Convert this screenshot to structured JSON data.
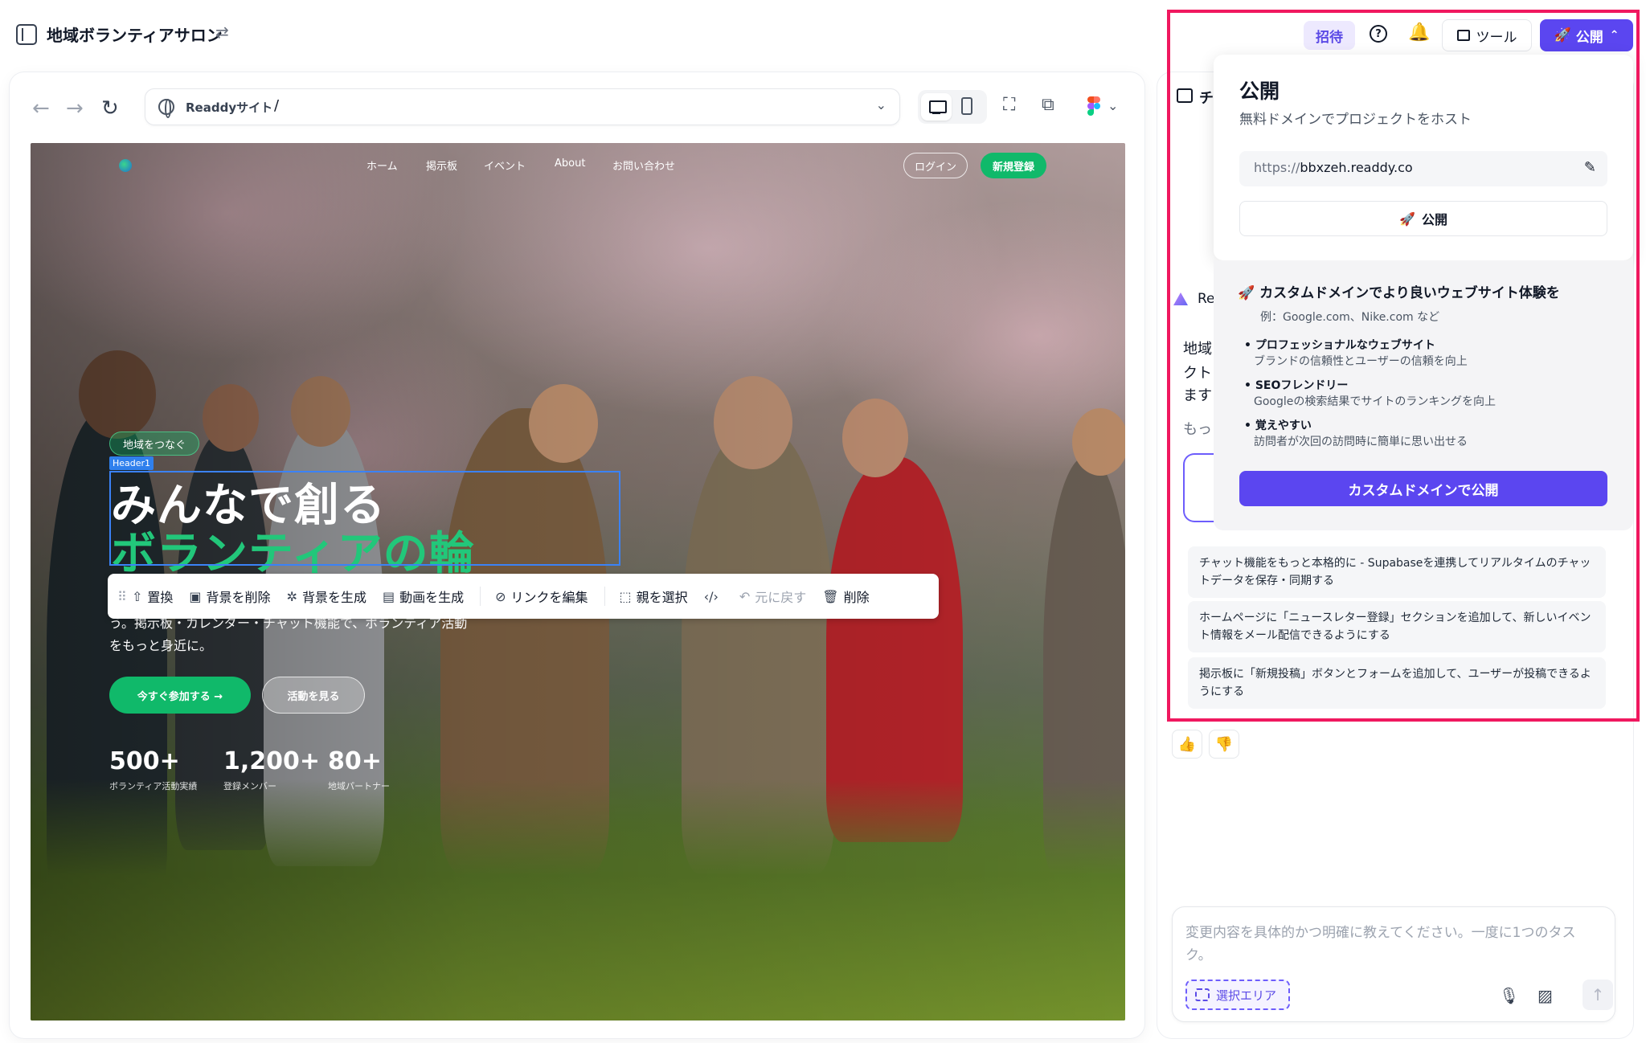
{
  "app": {
    "project_title": "地域ボランティアサロン"
  },
  "browser": {
    "site_name": "Readdyサイト",
    "path": "/"
  },
  "site": {
    "nav": [
      "ホーム",
      "掲示板",
      "イベント",
      "About",
      "お問い合わせ"
    ],
    "login_label": "ログイン",
    "signup_label": "新規登録",
    "badge": "地域をつなぐ",
    "selection_label": "Header1",
    "headline_1": "みんなで創る",
    "headline_2": "ボランティアの輪",
    "desc_line_1": "う。掲示板・カレンダー・チャット機能で、ボランティア活動",
    "desc_line_2": "をもっと身近に。",
    "cta_join": "今すぐ参加する →",
    "cta_view": "活動を見る",
    "stats": [
      {
        "value": "500+",
        "label": "ボランティア活動実績"
      },
      {
        "value": "1,200+",
        "label": "登録メンバー"
      },
      {
        "value": "80+",
        "label": "地域パートナー"
      }
    ]
  },
  "toolbar": {
    "replace": "置換",
    "remove_bg": "背景を削除",
    "gen_bg": "背景を生成",
    "gen_video": "動画を生成",
    "edit_link": "リンクを編集",
    "select_parent": "親を選択",
    "undo": "元に戻す",
    "delete": "削除"
  },
  "header": {
    "invite": "招待",
    "tools": "ツール",
    "publish": "公開"
  },
  "publish_popup": {
    "title": "公開",
    "subtitle": "無料ドメインでプロジェクトをホスト",
    "url_proto": "https://",
    "url_host": "bbxzeh.readdy.co",
    "publish_button": "公開"
  },
  "promo": {
    "title": "カスタムドメインでより良いウェブサイト体験を",
    "example": "例：Google.com、Nike.com など",
    "items": [
      {
        "title": "プロフェッショナルなウェブサイト",
        "desc": "ブランドの信頼性とユーザーの信頼を向上"
      },
      {
        "title": "SEOフレンドリー",
        "desc": "Googleの検索結果でサイトのランキングを向上"
      },
      {
        "title": "覚えやすい",
        "desc": "訪問者が次回の訪問時に簡単に思い出せる"
      }
    ],
    "cta": "カスタムドメインで公開"
  },
  "chat": {
    "tab_label": "チ",
    "readdy_label": "Re",
    "text_lines": [
      "地域",
      "クト",
      "ます",
      "もっ"
    ],
    "suggestions": [
      "チャット機能をもっと本格的に - Supabaseを連携してリアルタイムのチャットデータを保存・同期する",
      "ホームページに「ニュースレター登録」セクションを追加して、新しいイベント情報をメール配信できるようにする",
      "掲示板に「新規投稿」ボタンとフォームを追加して、ユーザーが投稿できるようにする"
    ],
    "input_placeholder": "変更内容を具体的かつ明確に教えてください。一度に1つのタスク。",
    "select_area": "選択エリア"
  },
  "colors": {
    "accent": "#5b46f0",
    "site_green": "#10b96a",
    "highlight": "#f0185f"
  }
}
